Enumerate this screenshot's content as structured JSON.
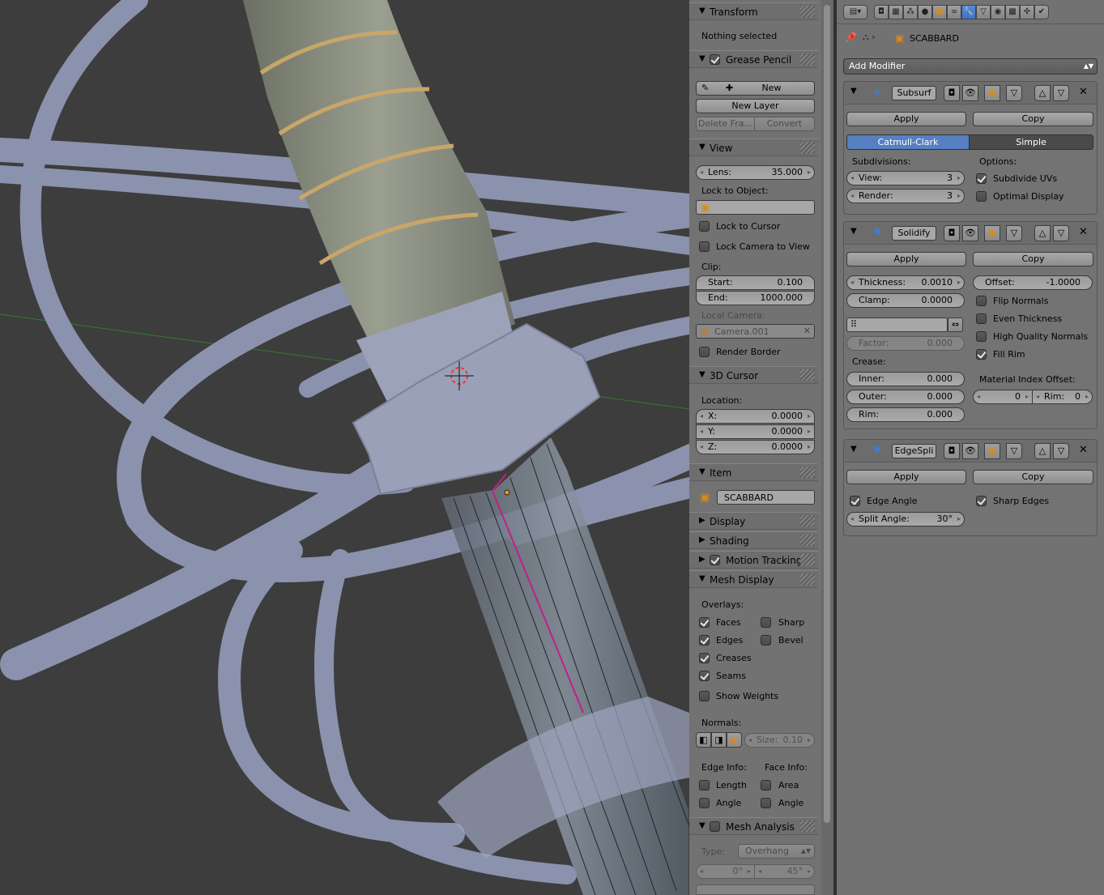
{
  "npanel": {
    "transform": {
      "title": "Transform",
      "status": "Nothing selected"
    },
    "grease_pencil": {
      "title": "Grease Pencil",
      "new_label": "New",
      "new_layer_label": "New Layer",
      "delete_frame_label": "Delete Fra...",
      "convert_label": "Convert"
    },
    "view": {
      "title": "View",
      "lens": {
        "label": "Lens:",
        "value": "35.000"
      },
      "lock_to_object_label": "Lock to Object:",
      "lock_to_cursor": "Lock to Cursor",
      "lock_camera_to_view": "Lock Camera to View",
      "clip_label": "Clip:",
      "clip_start": {
        "label": "Start:",
        "value": "0.100"
      },
      "clip_end": {
        "label": "End:",
        "value": "1000.000"
      },
      "local_camera_label": "Local Camera:",
      "local_camera_value": "Camera.001",
      "render_border": "Render Border"
    },
    "cursor": {
      "title": "3D Cursor",
      "location_label": "Location:",
      "x": {
        "label": "X:",
        "value": "0.0000"
      },
      "y": {
        "label": "Y:",
        "value": "0.0000"
      },
      "z": {
        "label": "Z:",
        "value": "0.0000"
      }
    },
    "item": {
      "title": "Item",
      "name": "SCABBARD"
    },
    "display": {
      "title": "Display"
    },
    "shading": {
      "title": "Shading"
    },
    "motion_tracking": {
      "title": "Motion Tracking"
    },
    "mesh_display": {
      "title": "Mesh Display",
      "overlays_label": "Overlays:",
      "faces": "Faces",
      "sharp": "Sharp",
      "edges": "Edges",
      "bevel": "Bevel",
      "creases": "Creases",
      "seams": "Seams",
      "show_weights": "Show Weights",
      "normals_label": "Normals:",
      "size": {
        "label": "Size:",
        "value": "0.10"
      },
      "edge_info_label": "Edge Info:",
      "face_info_label": "Face Info:",
      "length": "Length",
      "area": "Area",
      "angle_edge": "Angle",
      "angle_face": "Angle"
    },
    "mesh_analysis": {
      "title": "Mesh Analysis",
      "type_label": "Type:",
      "type_value": "Overhang",
      "min_value": "0°",
      "max_value": "45°"
    }
  },
  "properties": {
    "breadcrumb": "SCABBARD",
    "add_modifier": "Add Modifier",
    "subsurf": {
      "name": "Subsurf",
      "apply": "Apply",
      "copy": "Copy",
      "catmull_clark": "Catmull-Clark",
      "simple": "Simple",
      "subdivisions_label": "Subdivisions:",
      "options_label": "Options:",
      "view": {
        "label": "View:",
        "value": "3"
      },
      "render": {
        "label": "Render:",
        "value": "3"
      },
      "subdivide_uvs": "Subdivide UVs",
      "optimal_display": "Optimal Display"
    },
    "solidify": {
      "name": "Solidify",
      "apply": "Apply",
      "copy": "Copy",
      "thickness": {
        "label": "Thickness:",
        "value": "0.0010"
      },
      "offset": {
        "label": "Offset:",
        "value": "-1.0000"
      },
      "clamp": {
        "label": "Clamp:",
        "value": "0.0000"
      },
      "flip_normals": "Flip Normals",
      "even_thickness": "Even Thickness",
      "high_quality_normals": "High Quality Normals",
      "fill_rim": "Fill Rim",
      "factor": {
        "label": "Factor:",
        "value": "0.000"
      },
      "crease_label": "Crease:",
      "inner": {
        "label": "Inner:",
        "value": "0.000"
      },
      "outer": {
        "label": "Outer:",
        "value": "0.000"
      },
      "rim": {
        "label": "Rim:",
        "value": "0.000"
      },
      "material_index_offset_label": "Material Index Offset:",
      "mat_main": {
        "value": "0"
      },
      "mat_rim": {
        "label": "Rim:",
        "value": "0"
      }
    },
    "edgesplit": {
      "name": "EdgeSpli",
      "apply": "Apply",
      "copy": "Copy",
      "edge_angle": "Edge Angle",
      "sharp_edges": "Sharp Edges",
      "split_angle": {
        "label": "Split Angle:",
        "value": "30°"
      }
    }
  },
  "colors": {
    "selected_accent": "#5680c2",
    "viewport_bg": "#3d3d3d",
    "panel_bg": "#727272",
    "edge_highlight": "#c0208a"
  }
}
